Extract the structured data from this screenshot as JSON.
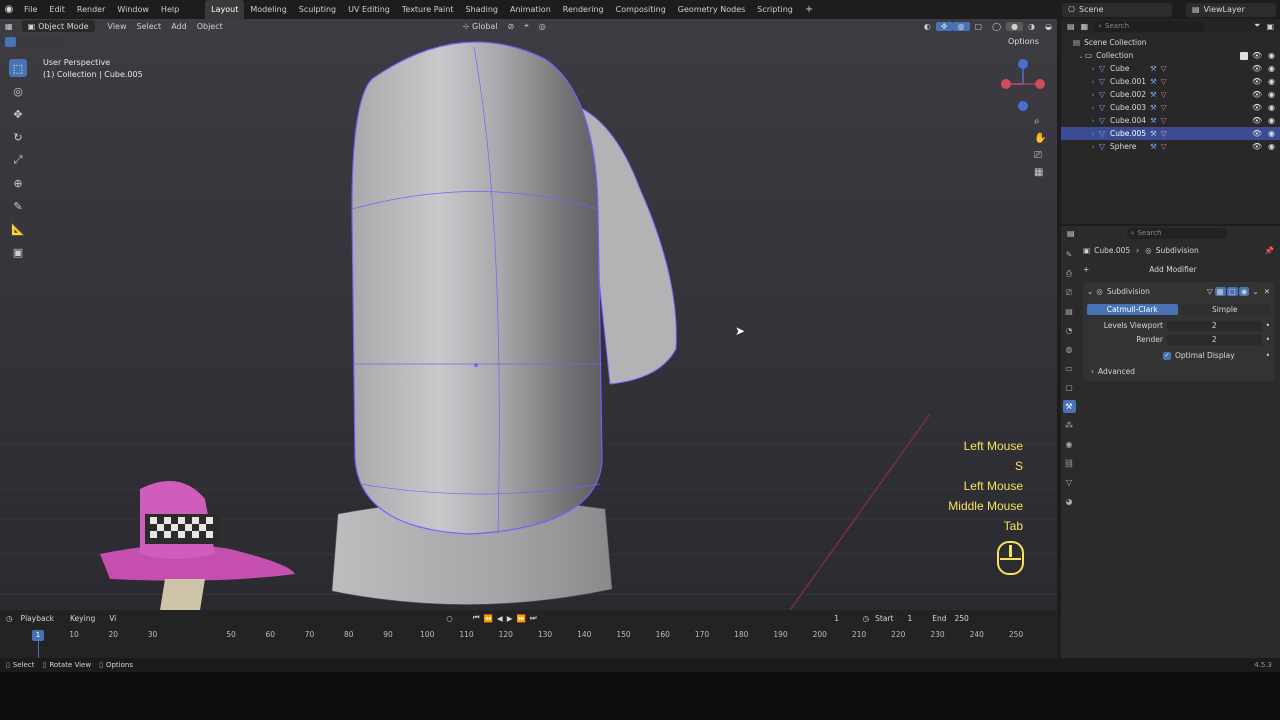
{
  "topbar": {
    "menus": [
      "File",
      "Edit",
      "Render",
      "Window",
      "Help"
    ],
    "workspaces": [
      "Layout",
      "Modeling",
      "Sculpting",
      "UV Editing",
      "Texture Paint",
      "Shading",
      "Animation",
      "Rendering",
      "Compositing",
      "Geometry Nodes",
      "Scripting"
    ],
    "active_workspace": "Layout",
    "scene": "Scene",
    "view_layer": "ViewLayer"
  },
  "viewport": {
    "mode": "Object Mode",
    "menus": [
      "View",
      "Select",
      "Add",
      "Object"
    ],
    "orientation": "Global",
    "options_label": "Options",
    "view_name": "User Perspective",
    "view_info": "(1) Collection | Cube.005"
  },
  "keys_overlay": [
    "Left Mouse",
    "S",
    "Left Mouse",
    "Middle Mouse",
    "Tab"
  ],
  "outliner": {
    "search_placeholder": "Search",
    "scene_collection": "Scene Collection",
    "collection": "Collection",
    "items": [
      "Cube",
      "Cube.001",
      "Cube.002",
      "Cube.003",
      "Cube.004",
      "Cube.005",
      "Sphere"
    ],
    "selected": "Cube.005"
  },
  "properties": {
    "search_placeholder": "Search",
    "breadcrumb_object": "Cube.005",
    "breadcrumb_modifier": "Subdivision",
    "add_modifier": "Add Modifier",
    "modifier_name": "Subdivision",
    "type_catmull": "Catmull-Clark",
    "type_simple": "Simple",
    "levels_viewport_label": "Levels Viewport",
    "levels_viewport_value": "2",
    "render_label": "Render",
    "render_value": "2",
    "optimal_display": "Optimal Display",
    "advanced": "Advanced"
  },
  "timeline": {
    "playback": "Playback",
    "keying": "Keying",
    "view": "Vi",
    "current_frame": "1",
    "start_label": "Start",
    "start_value": "1",
    "end_label": "End",
    "end_value": "250",
    "ticks": [
      "10",
      "20",
      "30",
      "50",
      "60",
      "70",
      "80",
      "90",
      "100",
      "110",
      "120",
      "130",
      "140",
      "150",
      "160",
      "170",
      "180",
      "190",
      "200",
      "210",
      "220",
      "230",
      "240",
      "250"
    ],
    "playhead": "1"
  },
  "statusbar": {
    "select": "Select",
    "rotate_view": "Rotate View",
    "options": "Options",
    "version": "4.5.3"
  },
  "colors": {
    "selection": "#4772b3",
    "outline": "#7c5cff",
    "key_overlay": "#f7e35a"
  }
}
